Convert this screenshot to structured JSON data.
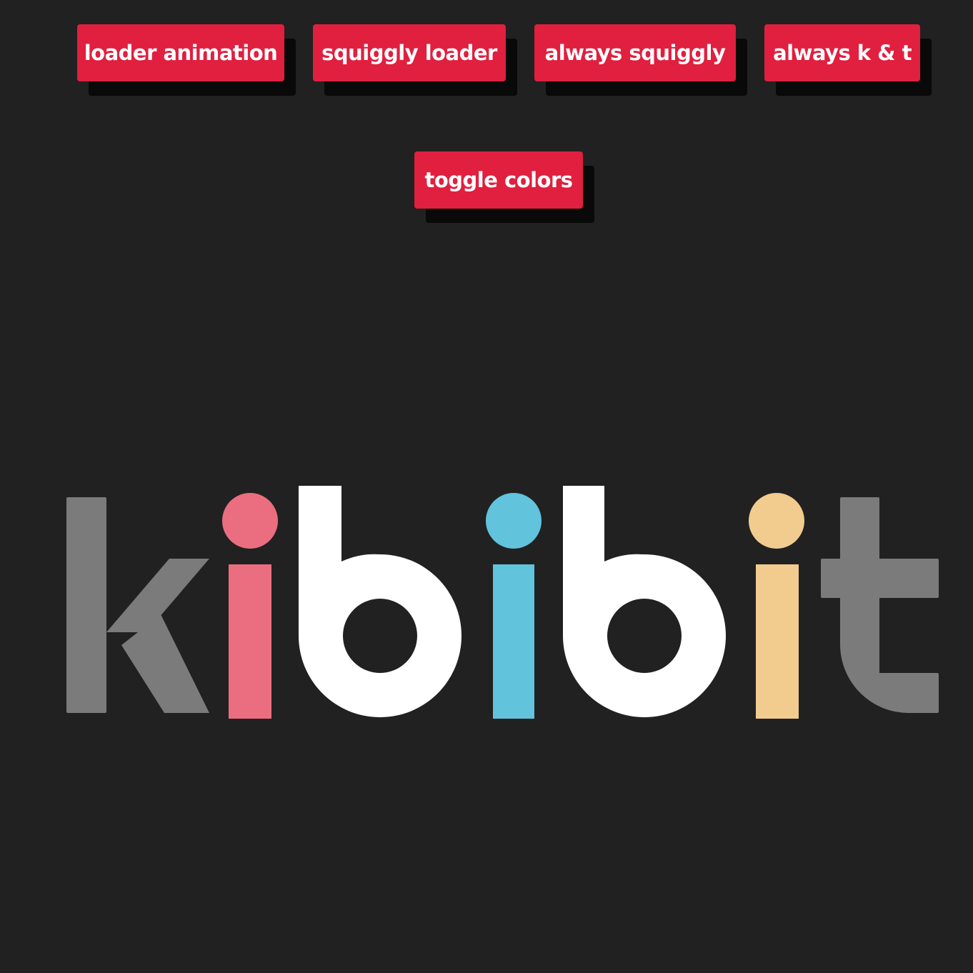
{
  "buttons": {
    "loader_animation": "loader animation",
    "squiggly_loader": "squiggly loader",
    "always_squiggly": "always squiggly",
    "always_k_t": "always k & t",
    "toggle_colors": "toggle colors"
  },
  "logo": {
    "text": "kibibit",
    "colors": {
      "k": "#7b7b7b",
      "i1": "#eb6e80",
      "b1": "#ffffff",
      "i2": "#61c3dc",
      "b2": "#ffffff",
      "i3": "#f2cc8e",
      "t": "#7b7b7b"
    }
  },
  "theme": {
    "background": "#212121",
    "button_color": "#e11f3f",
    "button_text_color": "#ffffff",
    "shadow_color": "#090909"
  }
}
